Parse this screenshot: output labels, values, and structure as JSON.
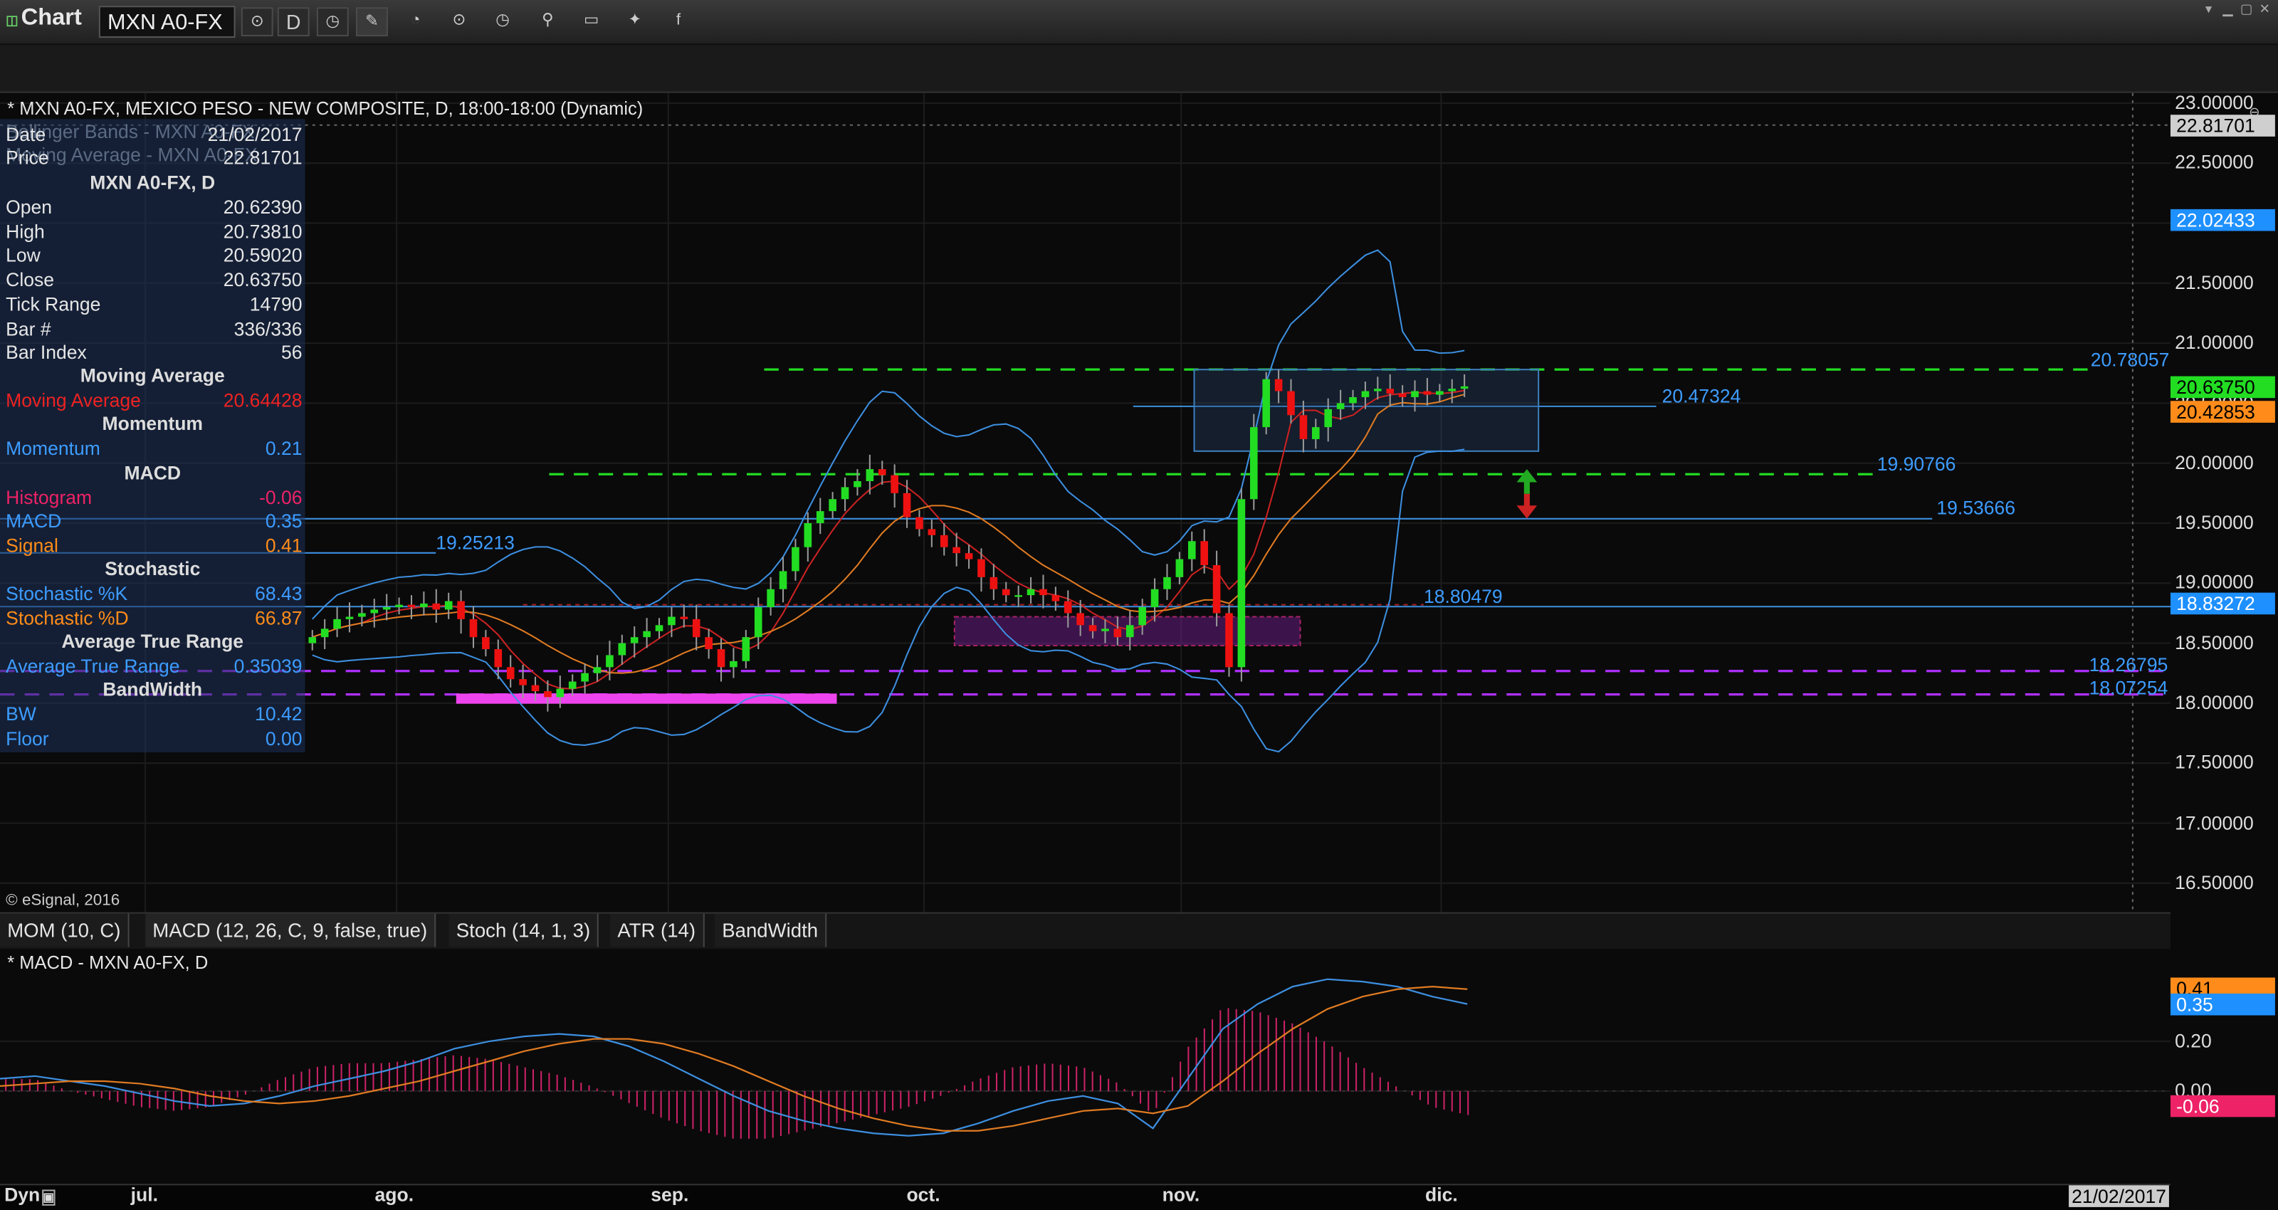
{
  "toolbar": {
    "app_label": "Chart",
    "symbol": "MXN A0-FX",
    "interval": "D"
  },
  "chart": {
    "title": "* MXN A0-FX, MEXICO PESO - NEW COMPOSITE, D, 18:00-18:00 (Dynamic)",
    "copyright": "© eSignal, 2016",
    "ghost_lines": [
      "Bollinger Bands - MXN A0-FX",
      "Moving Average - MXN A0-FX"
    ]
  },
  "info": {
    "date_label": "Date",
    "date_value": "21/02/2017",
    "price_label": "Price",
    "price_value": "22.81701",
    "symbol_header": "MXN A0-FX, D",
    "rows": [
      {
        "label": "Open",
        "value": "20.62390"
      },
      {
        "label": "High",
        "value": "20.73810"
      },
      {
        "label": "Low",
        "value": "20.59020"
      },
      {
        "label": "Close",
        "value": "20.63750"
      },
      {
        "label": "Tick Range",
        "value": "14790"
      },
      {
        "label": "Bar #",
        "value": "336/336"
      },
      {
        "label": "Bar Index",
        "value": "56"
      }
    ],
    "ma_header": "Moving Average",
    "ma_label": "Moving Average",
    "ma_value": "20.64428",
    "mom_header": "Momentum",
    "mom_label": "Momentum",
    "mom_value": "0.21",
    "macd_header": "MACD",
    "hist_label": "Histogram",
    "hist_value": "-0.06",
    "macd_label": "MACD",
    "macd_value": "0.35",
    "signal_label": "Signal",
    "signal_value": "0.41",
    "stoch_header": "Stochastic",
    "stochk_label": "Stochastic %K",
    "stochk_value": "68.43",
    "stochd_label": "Stochastic %D",
    "stochd_value": "66.87",
    "atr_header": "Average True Range",
    "atr_label": "Average True Range",
    "atr_value": "0.35039",
    "bw_header": "BandWidth",
    "bw_label": "BW",
    "bw_value": "10.42",
    "floor_label": "Floor",
    "floor_value": "0.00"
  },
  "colors": {
    "up": "#22dd22",
    "down": "#ee1111",
    "bb": "#3d8fe0",
    "ma_fast": "#cc2222",
    "ma_slow": "#e07b22",
    "green_level": "#22dd22",
    "purple_level": "#b030ff",
    "macd": "#3d8fe0",
    "signal": "#e07b22",
    "hist": "#cc2266"
  },
  "price_axis": {
    "ticks": [
      "23.00000",
      "22.50000",
      "22.00000",
      "21.50000",
      "21.00000",
      "20.50000",
      "20.00000",
      "19.50000",
      "19.00000",
      "18.50000",
      "18.00000",
      "17.50000",
      "17.00000",
      "16.50000"
    ],
    "tags": [
      {
        "text": "22.81701",
        "bg": "#cfcfcf",
        "fg": "#000"
      },
      {
        "text": "22.02433",
        "bg": "#1e90ff",
        "fg": "#fff"
      },
      {
        "text": "20.63750",
        "bg": "#22dd22",
        "fg": "#000"
      },
      {
        "text": "20.42853",
        "bg": "#ff8c1a",
        "fg": "#000"
      },
      {
        "text": "18.83272",
        "bg": "#1e90ff",
        "fg": "#fff"
      }
    ]
  },
  "levels": {
    "l1": "20.78057",
    "l2": "20.47324",
    "l3": "19.90766",
    "l4": "19.53666",
    "l5": "19.25213",
    "l6": "18.80479",
    "l7": "18.26795",
    "l8": "18.07254"
  },
  "macd_axis": {
    "ticks": [
      "0.20",
      "0.00"
    ],
    "tags": [
      {
        "text": "0.41",
        "bg": "#ff8c1a",
        "fg": "#000"
      },
      {
        "text": "0.35",
        "bg": "#1e90ff",
        "fg": "#fff"
      },
      {
        "text": "-0.06",
        "bg": "#ee2266",
        "fg": "#fff"
      }
    ]
  },
  "indicator_tabs": [
    "MOM (10, C)",
    "MACD (12, 26, C, 9, false, true)",
    "Stoch (14, 1, 3)",
    "ATR (14)",
    "BandWidth"
  ],
  "macd_title": "* MACD - MXN A0-FX, D",
  "date_axis": {
    "left_label": "Dyn",
    "months": [
      "jul.",
      "ago.",
      "sep.",
      "oct.",
      "nov.",
      "dic."
    ],
    "cursor_date": "21/02/2017"
  },
  "chart_data": {
    "type": "candlestick",
    "title": "* MXN A0-FX, MEXICO PESO - NEW COMPOSITE, D, 18:00-18:00 (Dynamic)",
    "ylim": [
      16.3,
      23.1
    ],
    "x_tick_labels": [
      "jul.",
      "ago.",
      "sep.",
      "oct.",
      "nov.",
      "dic."
    ],
    "candles_close": [
      18.55,
      18.62,
      18.7,
      18.72,
      18.75,
      18.78,
      18.8,
      18.82,
      18.8,
      18.83,
      18.78,
      18.85,
      18.7,
      18.55,
      18.45,
      18.3,
      18.2,
      18.15,
      18.1,
      18.05,
      18.12,
      18.18,
      18.25,
      18.3,
      18.4,
      18.5,
      18.55,
      18.6,
      18.65,
      18.72,
      18.7,
      18.55,
      18.45,
      18.3,
      18.35,
      18.55,
      18.8,
      18.95,
      19.1,
      19.3,
      19.5,
      19.6,
      19.7,
      19.8,
      19.85,
      19.95,
      19.9,
      19.75,
      19.55,
      19.45,
      19.4,
      19.3,
      19.25,
      19.2,
      19.05,
      18.95,
      18.9,
      18.9,
      18.95,
      18.9,
      18.85,
      18.75,
      18.65,
      18.6,
      18.62,
      18.55,
      18.65,
      18.8,
      18.95,
      19.05,
      19.2,
      19.35,
      19.15,
      18.75,
      18.3,
      19.7,
      20.3,
      20.7,
      20.6,
      20.4,
      20.2,
      20.3,
      20.45,
      20.5,
      20.55,
      20.6,
      20.62,
      20.58,
      20.55,
      20.6,
      20.57,
      20.6,
      20.62,
      20.64
    ],
    "horizontal_levels": [
      20.78057,
      20.47324,
      19.90766,
      19.53666,
      19.25213,
      18.80479,
      18.26795,
      18.07254
    ],
    "last_close": 20.6375,
    "macd_panel": {
      "ylim": [
        -0.35,
        0.55
      ],
      "series": [
        {
          "name": "MACD",
          "values": [
            0.05,
            0.06,
            0.04,
            0.02,
            -0.01,
            -0.04,
            -0.06,
            -0.05,
            -0.02,
            0.02,
            0.05,
            0.08,
            0.12,
            0.17,
            0.2,
            0.22,
            0.23,
            0.22,
            0.18,
            0.12,
            0.05,
            -0.02,
            -0.08,
            -0.12,
            -0.15,
            -0.17,
            -0.18,
            -0.17,
            -0.13,
            -0.08,
            -0.04,
            -0.02,
            -0.05,
            -0.15,
            0.05,
            0.25,
            0.35,
            0.42,
            0.45,
            0.44,
            0.42,
            0.38,
            0.35
          ]
        },
        {
          "name": "Signal",
          "values": [
            0.02,
            0.03,
            0.04,
            0.04,
            0.03,
            0.01,
            -0.02,
            -0.04,
            -0.05,
            -0.04,
            -0.02,
            0.01,
            0.04,
            0.08,
            0.12,
            0.16,
            0.19,
            0.21,
            0.21,
            0.19,
            0.15,
            0.1,
            0.04,
            -0.02,
            -0.07,
            -0.11,
            -0.14,
            -0.16,
            -0.16,
            -0.14,
            -0.11,
            -0.08,
            -0.07,
            -0.09,
            -0.06,
            0.04,
            0.15,
            0.25,
            0.33,
            0.38,
            0.41,
            0.42,
            0.41
          ]
        }
      ]
    }
  }
}
